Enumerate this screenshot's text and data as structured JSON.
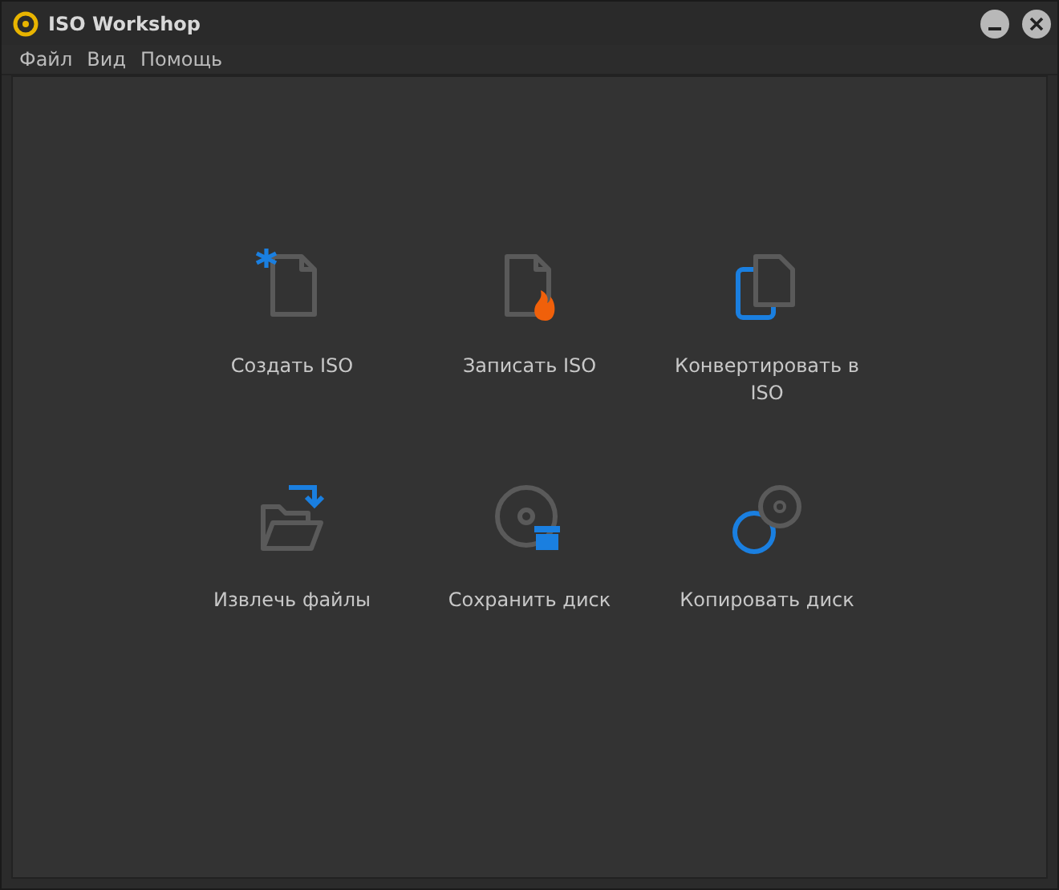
{
  "window": {
    "title": "ISO Workshop"
  },
  "menu": [
    "Файл",
    "Вид",
    "Помощь"
  ],
  "actions": [
    {
      "label": "Создать ISO",
      "kind": "new"
    },
    {
      "label": "Записать ISO",
      "kind": "burn"
    },
    {
      "label": "Конвертировать в ISO",
      "kind": "convert"
    },
    {
      "label": "Извлечь файлы",
      "kind": "extract"
    },
    {
      "label": "Сохранить диск",
      "kind": "save"
    },
    {
      "label": "Копировать диск",
      "kind": "copy"
    }
  ]
}
